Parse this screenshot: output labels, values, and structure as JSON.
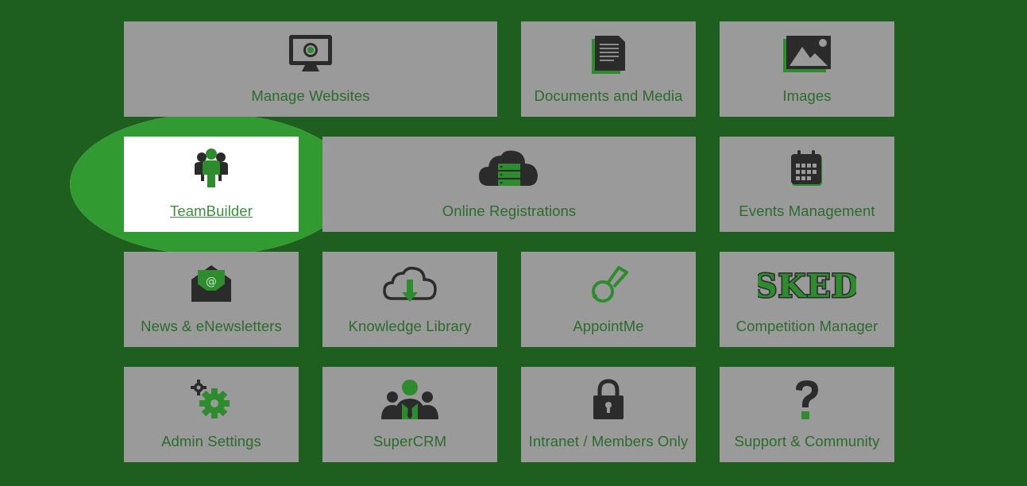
{
  "tiles": {
    "manage_websites": "Manage Websites",
    "documents_media": "Documents and Media",
    "images": "Images",
    "teambuilder": "TeamBuilder",
    "online_registrations": "Online Registrations",
    "events_management": "Events Management",
    "news": "News & eNewsletters",
    "knowledge_library": "Knowledge Library",
    "appointme": "AppointMe",
    "competition_manager": "Competition Manager",
    "admin_settings": "Admin Settings",
    "supercrm": "SuperCRM",
    "intranet": "Intranet / Members Only",
    "support": "Support & Community"
  },
  "sked_logo_text": "SKED",
  "icons": {
    "manage_websites": "monitor-icon",
    "documents_media": "document-icon",
    "images": "image-icon",
    "teambuilder": "team-icon",
    "online_registrations": "cloud-server-icon",
    "events_management": "calendar-icon",
    "news": "envelope-icon",
    "knowledge_library": "cloud-download-icon",
    "appointme": "whistle-icon",
    "competition_manager": "sked-logo-icon",
    "admin_settings": "gears-icon",
    "supercrm": "people-icon",
    "intranet": "lock-icon",
    "support": "question-icon"
  },
  "colors": {
    "background": "#1e5e1e",
    "tile": "#9a9a9a",
    "label": "#2b6b2b",
    "highlight": "#319a31",
    "icon_dark": "#2b2b2b",
    "icon_green": "#2e8b2e"
  }
}
